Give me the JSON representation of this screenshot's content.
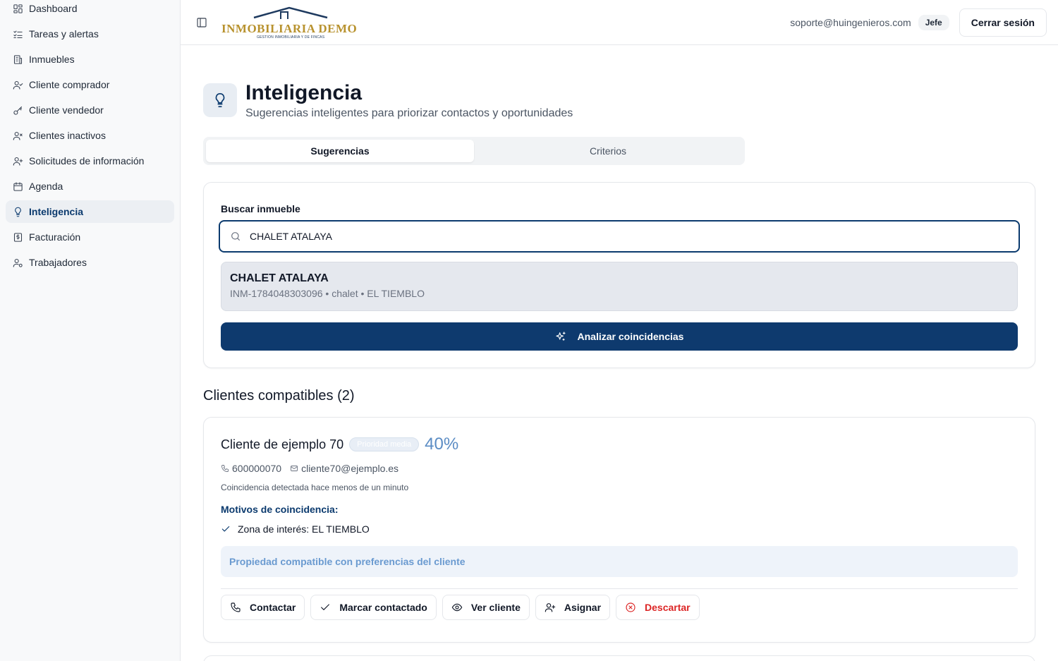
{
  "sidebar": {
    "items": [
      {
        "label": "Dashboard",
        "icon": "dashboard-icon",
        "active": false
      },
      {
        "label": "Tareas y alertas",
        "icon": "list-checks-icon",
        "active": false
      },
      {
        "label": "Inmuebles",
        "icon": "building-icon",
        "active": false
      },
      {
        "label": "Cliente comprador",
        "icon": "user-check-icon",
        "active": false
      },
      {
        "label": "Cliente vendedor",
        "icon": "key-icon",
        "active": false
      },
      {
        "label": "Clientes inactivos",
        "icon": "user-x-icon",
        "active": false
      },
      {
        "label": "Solicitudes de información",
        "icon": "user-plus-icon",
        "active": false
      },
      {
        "label": "Agenda",
        "icon": "calendar-icon",
        "active": false
      },
      {
        "label": "Inteligencia",
        "icon": "lightbulb-icon",
        "active": true
      },
      {
        "label": "Facturación",
        "icon": "receipt-icon",
        "active": false
      },
      {
        "label": "Trabajadores",
        "icon": "users-cog-icon",
        "active": false
      }
    ]
  },
  "topbar": {
    "logo_text": "INMOBILIARIA DEMO",
    "logo_subtext": "GESTION INMOBILIARIA Y DE FINCAS",
    "user_email": "soporte@huingenieros.com",
    "role": "Jefe",
    "logout_label": "Cerrar sesión"
  },
  "header": {
    "title": "Inteligencia",
    "subtitle": "Sugerencias inteligentes para priorizar contactos y oportunidades"
  },
  "tabs": [
    {
      "label": "Sugerencias",
      "active": true
    },
    {
      "label": "Criterios",
      "active": false
    }
  ],
  "search": {
    "label": "Buscar inmueble",
    "value": "CHALET ATALAYA",
    "placeholder": "",
    "result": {
      "name": "CHALET ATALAYA",
      "meta": "INM-1784048303096 • chalet • EL TIEMBLO"
    },
    "analyze_label": "Analizar coincidencias"
  },
  "matches": {
    "title": "Clientes compatibles (2)",
    "clients": [
      {
        "name": "Cliente de ejemplo 70",
        "priority": "Prioridad media",
        "score": "40%",
        "phone": "600000070",
        "email": "cliente70@ejemplo.es",
        "detected": "Coincidencia detectada hace menos de un minuto",
        "motives_title": "Motivos de coincidencia:",
        "motives": [
          "Zona de interés: EL TIEMBLO"
        ],
        "compat_note": "Propiedad compatible con preferencias del cliente",
        "actions": {
          "contact": "Contactar",
          "mark": "Marcar contactado",
          "view": "Ver cliente",
          "assign": "Asignar",
          "discard": "Descartar"
        }
      }
    ]
  },
  "colors": {
    "primary": "#0e3a6e",
    "accent_light": "#eef3fa",
    "score": "#5b8cc4",
    "danger": "#dc2626",
    "logo_gold": "#b8922e"
  }
}
